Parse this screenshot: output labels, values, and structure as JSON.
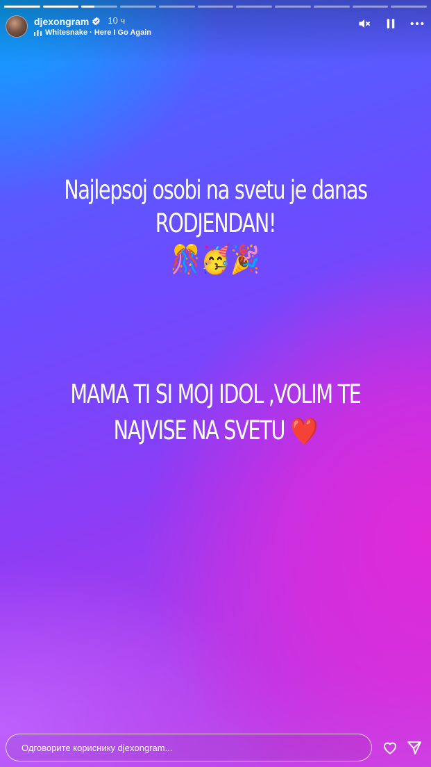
{
  "story": {
    "progress": [
      1,
      1,
      0.35,
      0,
      0,
      0,
      0,
      0,
      0,
      0,
      0
    ],
    "username": "djexongram",
    "time_ago": "10 ч",
    "music": "Whitesnake · Here I Go Again",
    "icons": {
      "verified": "verified-badge-icon",
      "music": "music-bars-icon",
      "mute": "speaker-muted-icon",
      "pause": "pause-icon",
      "more": "more-horizontal-icon",
      "like": "heart-outline-icon",
      "share": "paper-plane-icon"
    },
    "text_line1": "Najlepsoj osobi na svetu je danas",
    "text_line2": "RODJENDAN!",
    "emojis": "🎊🥳🎉",
    "text_line3": "MAMA TI SI MOJ IDOL ,VOLIM TE",
    "text_line4": "NAJVISE NA SVETU",
    "heart_emoji": "❤️"
  },
  "reply": {
    "placeholder": "Одговорите кориснику djexongram..."
  },
  "colors": {
    "gradient_top_left": "#0aa6ff",
    "gradient_mid": "#6a4dff",
    "gradient_bottom_right": "#e02ad8"
  }
}
